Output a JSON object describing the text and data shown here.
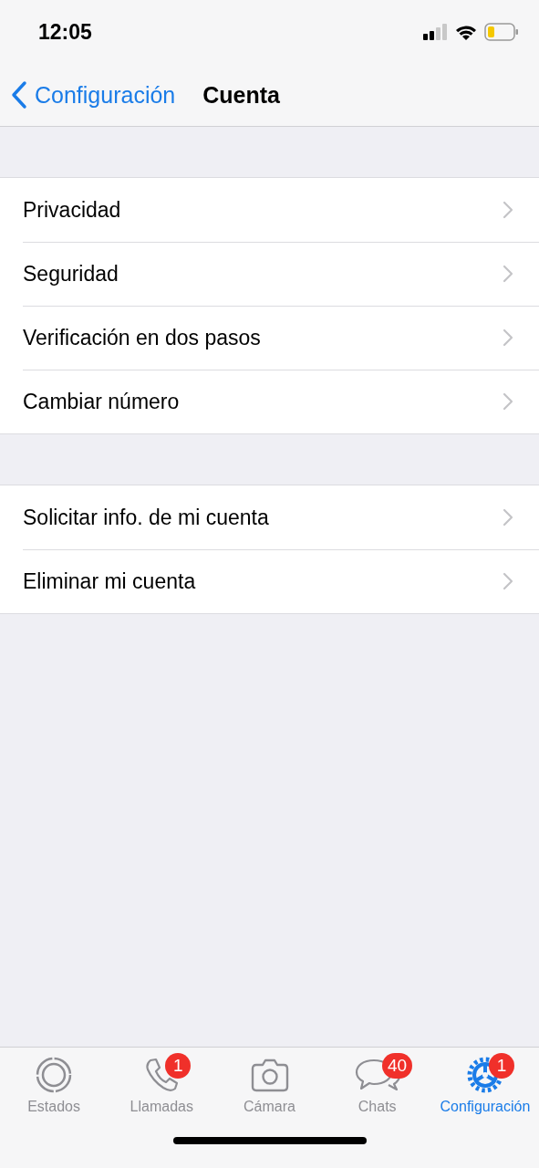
{
  "status_bar": {
    "time": "12:05"
  },
  "nav": {
    "back": "Configuración",
    "title": "Cuenta"
  },
  "groups": [
    {
      "items": [
        "Privacidad",
        "Seguridad",
        "Verificación en dos pasos",
        "Cambiar número"
      ]
    },
    {
      "items": [
        "Solicitar info. de mi cuenta",
        "Eliminar mi cuenta"
      ]
    }
  ],
  "tabs": [
    {
      "label": "Estados",
      "selected": false
    },
    {
      "label": "Llamadas",
      "badge": "1",
      "selected": false
    },
    {
      "label": "Cámara",
      "selected": false
    },
    {
      "label": "Chats",
      "badge": "40",
      "selected": false
    },
    {
      "label": "Configuración",
      "badge": "1",
      "selected": true
    }
  ]
}
